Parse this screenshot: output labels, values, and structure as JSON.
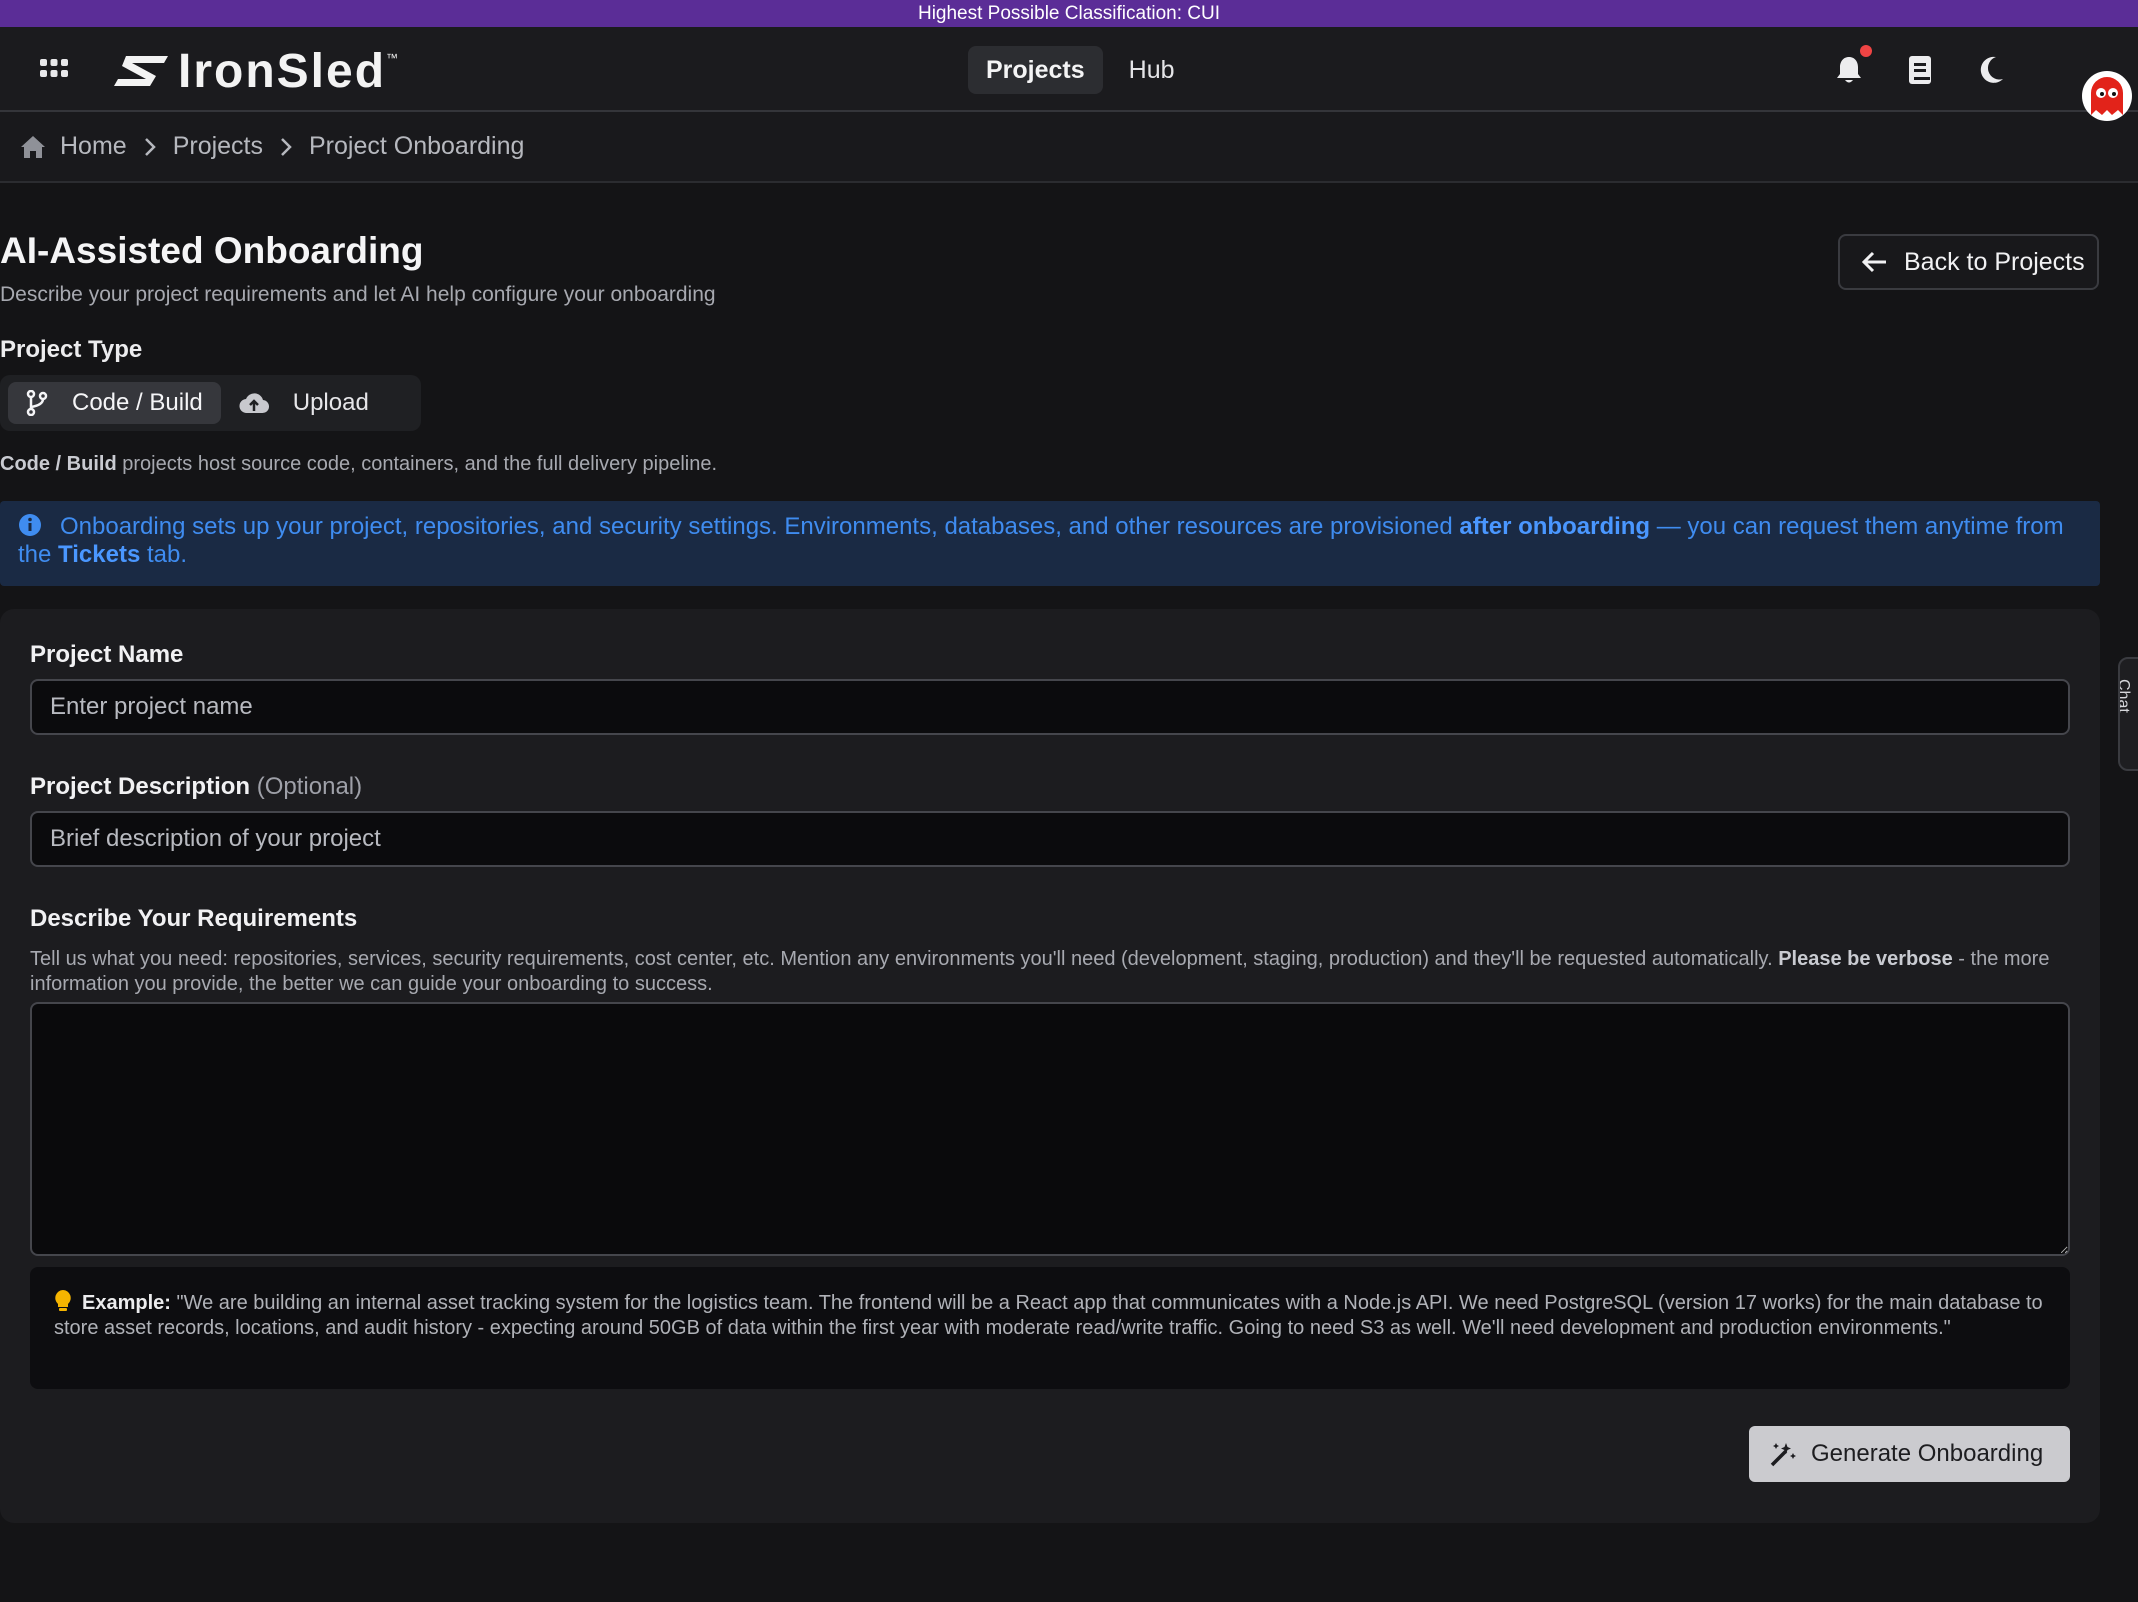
{
  "classification_banner": "Highest Possible Classification: CUI",
  "header": {
    "logo_text": "IronSled",
    "logo_tm": "™",
    "nav": [
      {
        "label": "Projects",
        "active": true
      },
      {
        "label": "Hub",
        "active": false
      }
    ],
    "icons": [
      "apps-grid-icon",
      "bell-icon",
      "book-icon",
      "moon-icon",
      "avatar"
    ],
    "notification_dot_color": "#ef4444"
  },
  "breadcrumb": {
    "items": [
      "Home",
      "Projects",
      "Project Onboarding"
    ]
  },
  "page": {
    "title": "AI-Assisted Onboarding",
    "subtitle": "Describe your project requirements and let AI help configure your onboarding",
    "back_button": "Back to Projects"
  },
  "project_type": {
    "label": "Project Type",
    "options": [
      {
        "label": "Code / Build",
        "icon": "git-branch-icon",
        "active": true
      },
      {
        "label": "Upload",
        "icon": "cloud-upload-icon",
        "active": false
      }
    ],
    "description_bold": "Code / Build",
    "description_rest": " projects host source code, containers, and the full delivery pipeline."
  },
  "info_banner": {
    "text1": "Onboarding sets up your project, repositories, and security settings. Environments, databases, and other resources are provisioned ",
    "bold1": "after onboarding",
    "text2": " — you can request them anytime from the ",
    "bold2": "Tickets",
    "text3": " tab.",
    "color": "#3f8cf0"
  },
  "form": {
    "project_name": {
      "label": "Project Name",
      "placeholder": "Enter project name",
      "value": ""
    },
    "project_description": {
      "label": "Project Description",
      "optional": "(Optional)",
      "placeholder": "Brief description of your project",
      "value": ""
    },
    "requirements": {
      "label": "Describe Your Requirements",
      "help_text": "Tell us what you need: repositories, services, security requirements, cost center, etc. Mention any environments you'll need (development, staging, production) and they'll be requested automatically. ",
      "help_bold": "Please be verbose",
      "help_rest": " - the more information you provide, the better we can guide your onboarding to success.",
      "value": ""
    },
    "example": {
      "label": "Example:",
      "text": " \"We are building an internal asset tracking system for the logistics team. The frontend will be a React app that communicates with a Node.js API. We need PostgreSQL (version 17 works) for the main database to store asset records, locations, and audit history - expecting around 50GB of data within the first year with moderate read/write traffic. Going to need S3 as well. We'll need development and production environments.\""
    },
    "generate_button": "Generate Onboarding"
  },
  "chat_tab": "Chat"
}
